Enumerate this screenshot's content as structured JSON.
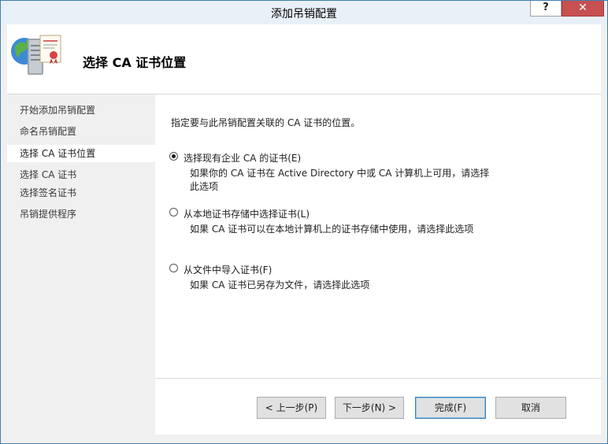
{
  "window": {
    "title": "添加吊销配置",
    "help_glyph": "?",
    "close_glyph": "✕"
  },
  "header": {
    "title": "选择 CA 证书位置",
    "icon": "certificate-server-icon"
  },
  "nav": {
    "items": [
      {
        "label": "开始添加吊销配置",
        "active": false
      },
      {
        "label": "命名吊销配置",
        "active": false
      },
      {
        "label": "选择 CA 证书位置",
        "active": true
      },
      {
        "label": "选择 CA 证书",
        "active": false
      },
      {
        "label": "选择签名证书",
        "active": false
      },
      {
        "label": "吊销提供程序",
        "active": false
      }
    ]
  },
  "content": {
    "description": "指定要与此吊销配置关联的 CA 证书的位置。",
    "options": [
      {
        "label": "选择现有企业 CA 的证书(E)",
        "selected": true,
        "desc_line1": "如果你的 CA 证书在 Active Directory 中或 CA 计算机上可用，请选择",
        "desc_line2": "此选项"
      },
      {
        "label": "从本地证书存储中选择证书(L)",
        "selected": false,
        "desc_line1": "如果 CA 证书可以在本地计算机上的证书存储中使用，请选择此选项"
      },
      {
        "label": "从文件中导入证书(F)",
        "selected": false,
        "desc_line1": "如果 CA 证书已另存为文件，请选择此选项"
      }
    ]
  },
  "buttons": {
    "back": "< 上一步(P)",
    "next": "下一步(N) >",
    "finish": "完成(F)",
    "cancel": "取消"
  },
  "colors": {
    "title_bar": "#e9f0f8",
    "close_button": "#c75050",
    "window_border": "#3c7fb1"
  }
}
